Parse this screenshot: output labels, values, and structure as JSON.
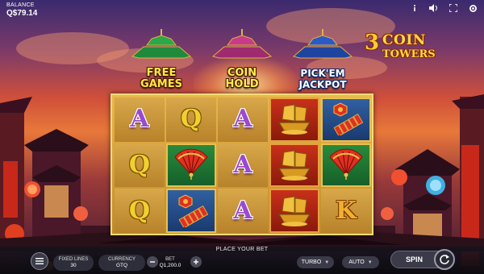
{
  "hud": {
    "balance_label": "BALANCE",
    "balance_value": "Q$79.14",
    "icons": [
      "info-icon",
      "sound-icon",
      "fullscreen-icon",
      "settings-icon"
    ]
  },
  "logo": {
    "number": "3",
    "line1": "COIN",
    "line2": "TOWERS"
  },
  "towers": [
    {
      "line1": "FREE",
      "line2": "GAMES",
      "color": "#2aa84a"
    },
    {
      "line1": "COIN",
      "line2": "HOLD",
      "color": "#c83a8a"
    },
    {
      "line1": "PICK'EM",
      "line2": "JACKPOT",
      "color": "#2a5ac8"
    }
  ],
  "reels": {
    "symbols": [
      [
        "A",
        "Q",
        "A",
        "ship",
        "firecracker"
      ],
      [
        "Q",
        "fan",
        "A",
        "ship",
        "fan"
      ],
      [
        "Q",
        "firecracker",
        "A",
        "ship",
        "K"
      ]
    ]
  },
  "bottom": {
    "prompt": "PLACE YOUR BET",
    "fixed_lines_label": "FIXED LINES",
    "fixed_lines_value": "30",
    "currency_label": "CURRENCY",
    "currency_value": "GTQ",
    "bet_label": "BET",
    "bet_value": "Q1,200.0",
    "turbo_label": "TURBO",
    "auto_label": "AUTO",
    "spin_label": "SPIN"
  }
}
